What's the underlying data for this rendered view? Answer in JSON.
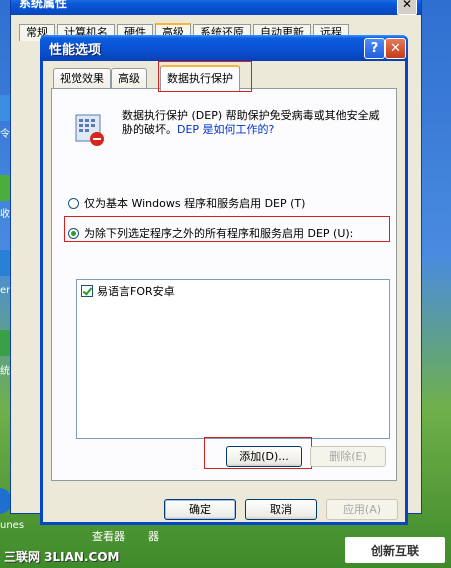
{
  "background_window": {
    "title": "系统属性",
    "tabs": [
      "常规",
      "计算机名",
      "硬件",
      "高级",
      "系统还原",
      "自动更新",
      "远程"
    ],
    "active_tab_index": 3
  },
  "desktop": {
    "side_labels": [
      "令",
      "收",
      "er",
      "统",
      "unes"
    ],
    "bottom_labels": [
      "查看器",
      "器"
    ]
  },
  "dialog": {
    "title": "性能选项",
    "help_glyph": "?",
    "close_glyph": "✕",
    "tabs": [
      {
        "label": "视觉效果"
      },
      {
        "label": "高级"
      },
      {
        "label": "数据执行保护"
      }
    ],
    "active_tab_index": 2,
    "intro_text": "数据执行保护 (DEP) 帮助保护免受病毒或其他安全威胁的破坏。",
    "intro_link": "DEP 是如何工作的?",
    "radio_options": [
      {
        "label": "仅为基本 Windows 程序和服务启用 DEP (T)",
        "checked": false
      },
      {
        "label": "为除下列选定程序之外的所有程序和服务启用 DEP (U):",
        "checked": true
      }
    ],
    "programs": [
      {
        "label": "易语言FOR安卓",
        "checked": true
      }
    ],
    "add_button": "添加(D)...",
    "remove_button": "删除(E)",
    "ok_button": "确定",
    "cancel_button": "取消",
    "apply_button": "应用(A)",
    "colors": {
      "title_blue": "#0a52d4",
      "annotation_red": "#d42020",
      "tab_highlight": "#f9b43a"
    }
  },
  "watermarks": {
    "left": "三联网 3LIAN.COM",
    "right": "创新互联"
  }
}
